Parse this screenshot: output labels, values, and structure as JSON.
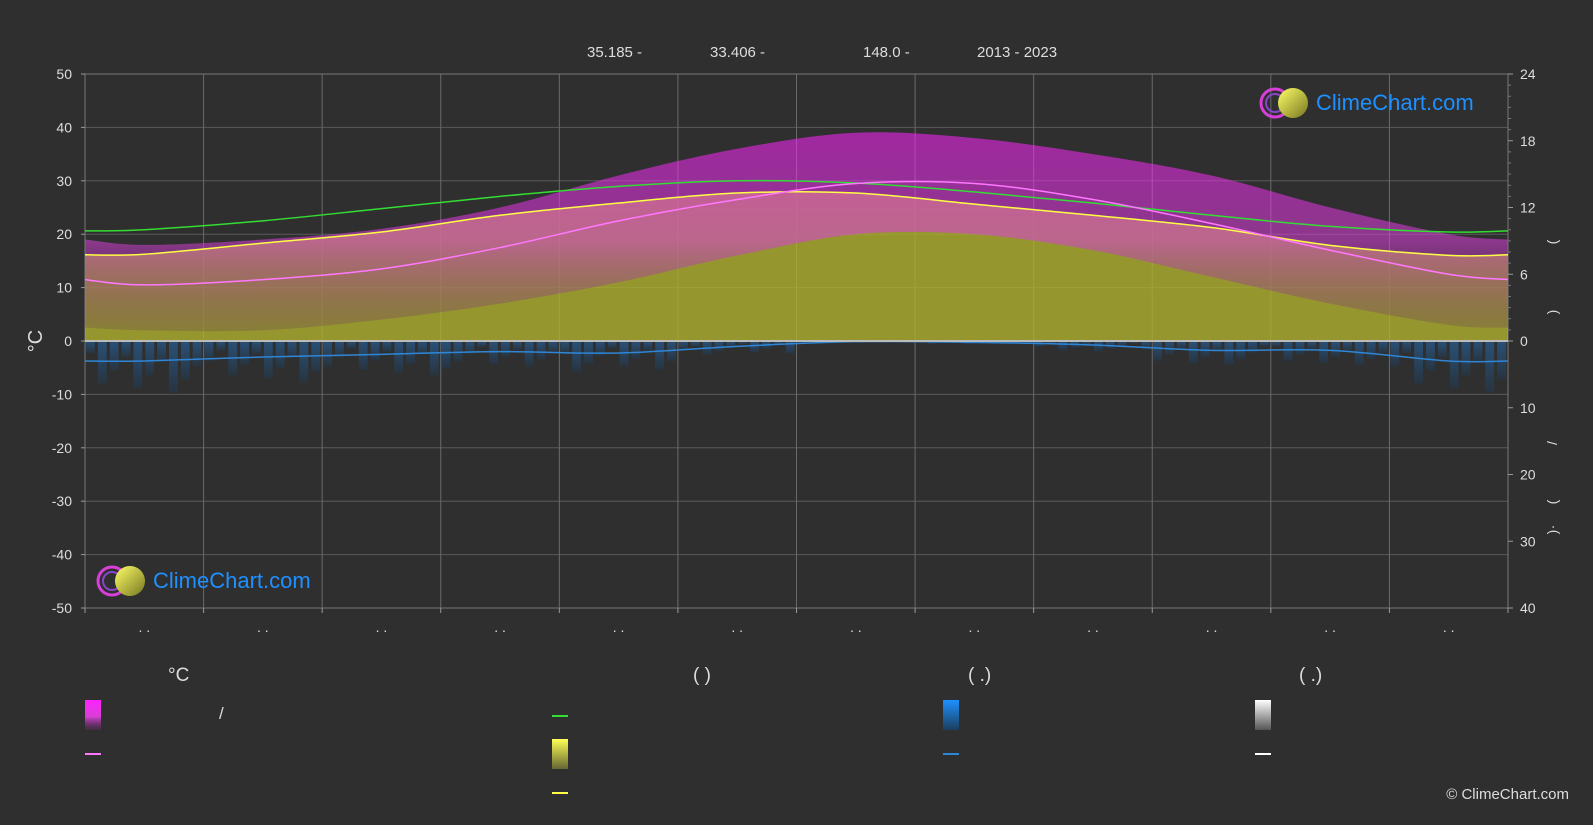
{
  "header": {
    "latitude": "35.185 -",
    "longitude": "33.406 -",
    "elevation": "148.0 -",
    "years": "2013 - 2023"
  },
  "brand": {
    "logo_text": "ClimeChart.com",
    "copyright": "© ClimeChart.com"
  },
  "colors": {
    "background": "#2f2f2f",
    "temp_range": "#d83fd8",
    "daily_mean": "#ff77ff",
    "daylight": "#33dd33",
    "sunshine_area": "#b0b030",
    "sunshine_line": "#ffff44",
    "rain": "#2f86d6",
    "snow": "#ffffff"
  },
  "chart_data": {
    "type": "area",
    "x_tick_labels": [
      ". .",
      ". .",
      ". .",
      ". .",
      ". .",
      ". .",
      ". .",
      ". .",
      ". .",
      ". .",
      ". .",
      ". ."
    ],
    "ylabel_left": "°C",
    "ylim_left": [
      -50,
      50
    ],
    "yticks_left": [
      50,
      40,
      30,
      20,
      10,
      0,
      -10,
      -20,
      -30,
      -40,
      -50
    ],
    "right_axis_upper_ticks": [
      24,
      18,
      12,
      6,
      0
    ],
    "right_axis_lower_ticks": [
      10,
      20,
      30,
      40
    ],
    "right_axis_label_glyphs": [
      "(",
      ")",
      "/",
      "(",
      "·",
      ")"
    ],
    "grid": true,
    "series": [
      {
        "key": "daylight_hours",
        "values": [
          10.0,
          10.8,
          11.9,
          13.0,
          13.9,
          14.4,
          14.2,
          13.4,
          12.4,
          11.3,
          10.3,
          9.8
        ]
      },
      {
        "key": "sunshine_hours",
        "values": [
          7.8,
          8.8,
          9.8,
          11.3,
          12.4,
          13.3,
          13.3,
          12.3,
          11.3,
          10.2,
          8.6,
          7.7
        ]
      },
      {
        "key": "mean_temp_c",
        "values": [
          10.5,
          11.5,
          13.5,
          17.5,
          22.5,
          26.5,
          29.5,
          29.5,
          26.5,
          22.0,
          17.0,
          12.5
        ]
      },
      {
        "key": "temp_band_top_c",
        "values": [
          18,
          19,
          21,
          25,
          31,
          36,
          39,
          38,
          35,
          31,
          25,
          20
        ]
      },
      {
        "key": "temp_band_bottom_c",
        "values": [
          2,
          2,
          4,
          7,
          11,
          16,
          20,
          20,
          17,
          12,
          7,
          3
        ]
      },
      {
        "key": "precipitation_mm",
        "values": [
          3.0,
          2.4,
          2.0,
          1.6,
          1.8,
          0.8,
          0.1,
          0.2,
          0.6,
          1.4,
          1.4,
          3.0
        ]
      }
    ]
  },
  "legend": {
    "col1": {
      "head": "°C",
      "text1": "/"
    },
    "col2": {
      "head": "(          )"
    },
    "col3": {
      "head": "(    .)"
    },
    "col4": {
      "head": "(    .)"
    }
  }
}
